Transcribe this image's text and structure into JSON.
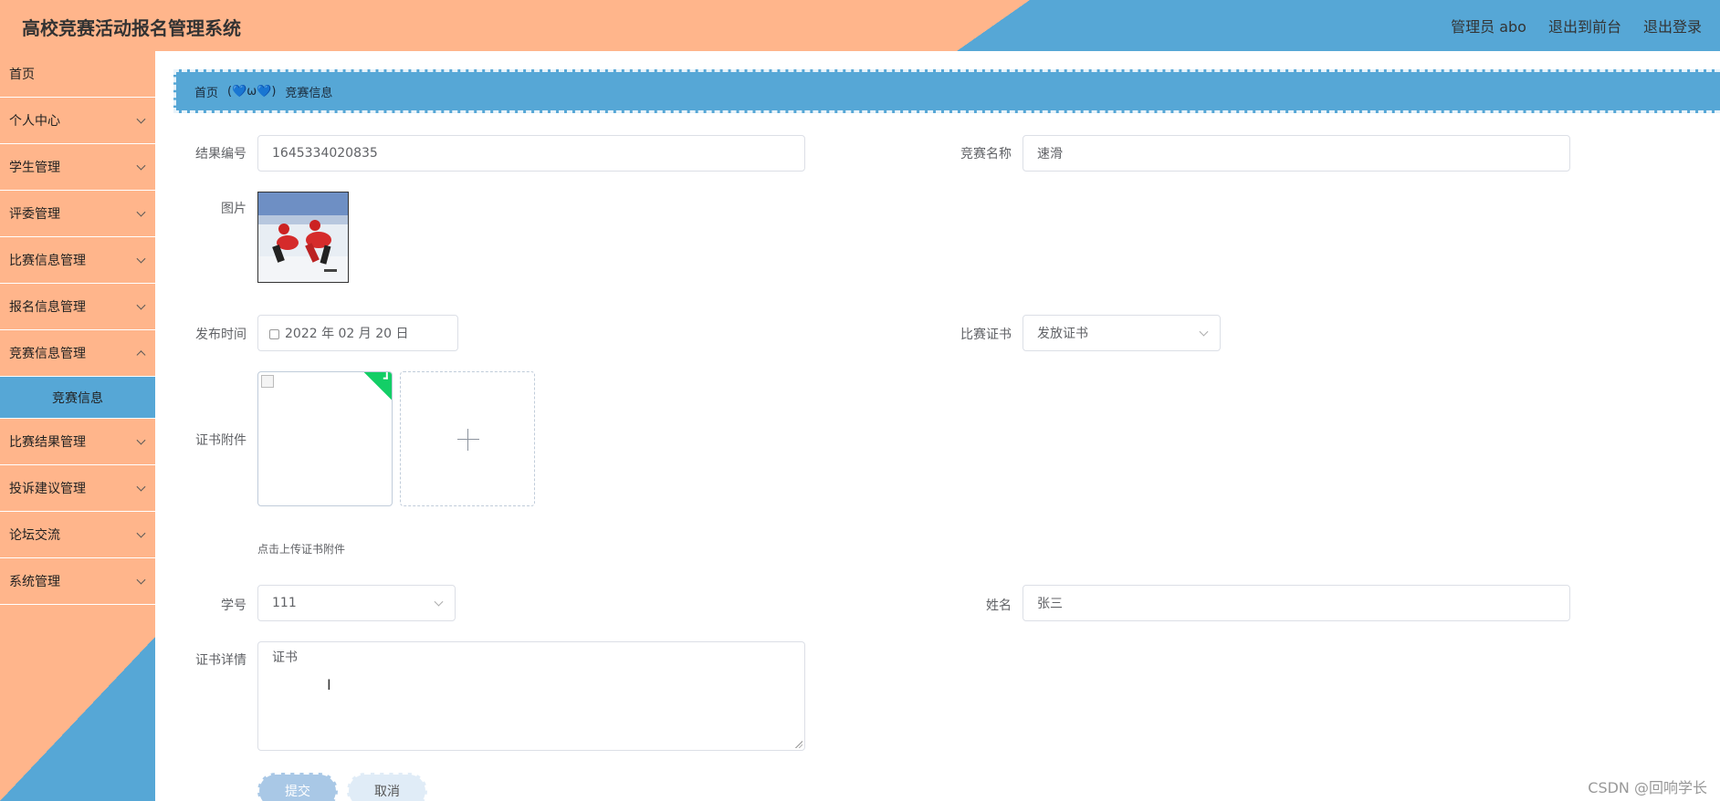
{
  "header": {
    "title": "高校竞赛活动报名管理系统",
    "actions": [
      "管理员 abo",
      "退出到前台",
      "退出登录"
    ]
  },
  "sidebar": {
    "items": [
      {
        "label": "首页",
        "has_children": false
      },
      {
        "label": "个人中心",
        "has_children": true
      },
      {
        "label": "学生管理",
        "has_children": true
      },
      {
        "label": "评委管理",
        "has_children": true
      },
      {
        "label": "比赛信息管理",
        "has_children": true
      },
      {
        "label": "报名信息管理",
        "has_children": true
      },
      {
        "label": "竞赛信息管理",
        "has_children": true
      },
      {
        "label": "竞赛信息",
        "has_children": false,
        "active": true
      },
      {
        "label": "比赛结果管理",
        "has_children": true
      },
      {
        "label": "投诉建议管理",
        "has_children": true
      },
      {
        "label": "论坛交流",
        "has_children": true
      },
      {
        "label": "系统管理",
        "has_children": true
      }
    ]
  },
  "breadcrumb": {
    "home": "首页",
    "separator": "(💙ω💙)",
    "current": "竞赛信息"
  },
  "form": {
    "result_no": {
      "label": "结果编号",
      "value": "1645334020835"
    },
    "competition_name": {
      "label": "竞赛名称",
      "value": "速滑"
    },
    "picture": {
      "label": "图片"
    },
    "publish_time": {
      "label": "发布时间",
      "value": "2022 年 02 月 20 日"
    },
    "certificate": {
      "label": "比赛证书",
      "value": "发放证书"
    },
    "attachment": {
      "label": "证书附件",
      "tip": "点击上传证书附件"
    },
    "student_no": {
      "label": "学号",
      "value": "111"
    },
    "name": {
      "label": "姓名",
      "value": "张三"
    },
    "cert_detail": {
      "label": "证书详情",
      "value": "证书"
    },
    "submit_label": "提交",
    "cancel_label": "取消"
  },
  "watermark": "CSDN @回响学长",
  "colors": {
    "peach": "#ffb58b",
    "blue": "#56a7d6",
    "success": "#13ce66"
  }
}
